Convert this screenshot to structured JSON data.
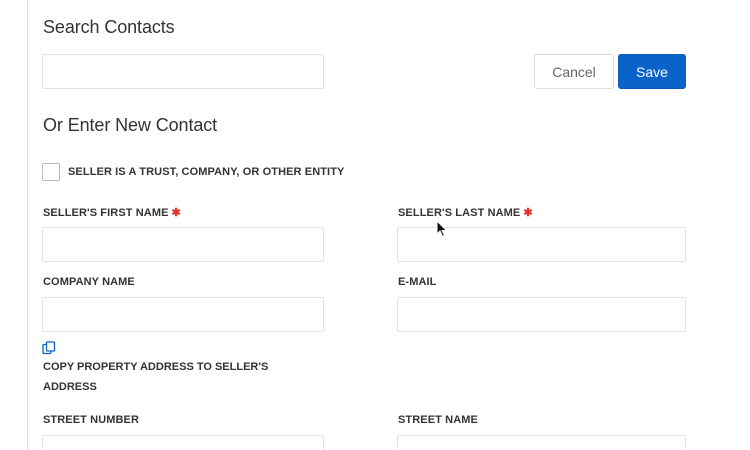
{
  "search": {
    "title": "Search Contacts",
    "input_value": "",
    "cancel_label": "Cancel",
    "save_label": "Save"
  },
  "new_contact": {
    "title": "Or Enter New Contact",
    "entity_checkbox_label": "SELLER IS A TRUST, COMPANY, OR OTHER ENTITY",
    "entity_checked": false,
    "required_marker": "✱",
    "fields": {
      "first_name_label": "SELLER'S FIRST NAME",
      "first_name_value": "",
      "last_name_label": "SELLER'S LAST NAME",
      "last_name_value": "",
      "company_label": "COMPANY NAME",
      "company_value": "",
      "email_label": "E-MAIL",
      "email_value": "",
      "street_number_label": "STREET NUMBER",
      "street_number_value": "",
      "street_name_label": "STREET NAME",
      "street_name_value": ""
    },
    "copy_address_label": "COPY PROPERTY ADDRESS TO SELLER'S ADDRESS",
    "copy_icon": "copy-icon"
  },
  "colors": {
    "primary": "#0a63c9",
    "required": "#e0322c",
    "border": "#e3e3e3"
  }
}
